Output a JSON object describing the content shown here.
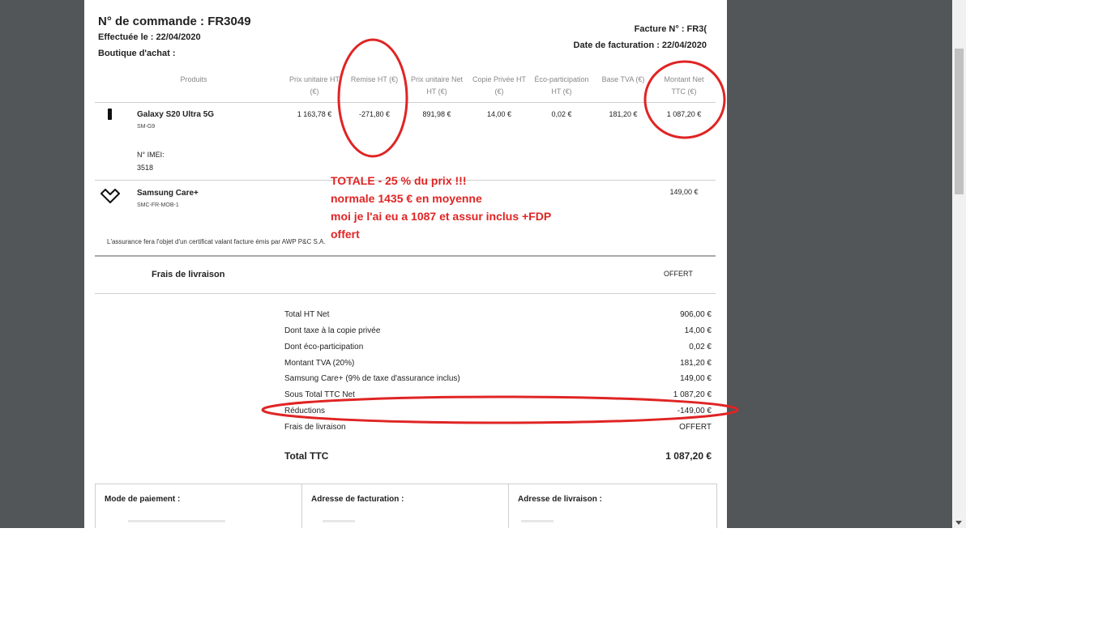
{
  "order": {
    "number_label": "N° de commande : FR3049",
    "date_label": "Effectuée le : 22/04/2020",
    "shop_label": "Boutique d'achat :",
    "invoice_number_label": "Facture N° : FR3(",
    "invoice_date_label": "Date de facturation : 22/04/2020"
  },
  "table": {
    "headers": [
      "Produits",
      "Prix unitaire HT",
      "(€)",
      "Remise HT (€)",
      "Prix unitaire Net",
      "HT (€)",
      "Copie Privée HT",
      "(€)",
      "Éco-participation",
      "HT (€)",
      "Base TVA (€)",
      "Montant Net",
      "TTC (€)"
    ],
    "product": {
      "name": "Galaxy S20 Ultra 5G",
      "ref": "SM-G9",
      "imei_label": "N° IMEI:",
      "imei_value": "3518",
      "unit_price_ht": "1 163,78 €",
      "discount_ht": "-271,80 €",
      "unit_net_ht": "891,98 €",
      "private_copy": "14,00 €",
      "eco_participation": "0,02 €",
      "vat_base": "181,20 €",
      "net_ttc": "1 087,20 €"
    },
    "insurance": {
      "name": "Samsung Care+",
      "ref": "SMC-FR-MOB-1",
      "amount": "149,00 €",
      "note": "L'assurance fera l'objet d'un certificat valant facture émis par AWP P&C S.A."
    },
    "delivery": {
      "label": "Frais de livraison",
      "value": "OFFERT"
    }
  },
  "totals": [
    {
      "label": "Total HT Net",
      "value": "906,00 €"
    },
    {
      "label": "Dont taxe à la copie privée",
      "value": "14,00 €"
    },
    {
      "label": "Dont éco-participation",
      "value": "0,02 €"
    },
    {
      "label": "Montant TVA (20%)",
      "value": "181,20 €"
    },
    {
      "label": "Samsung Care+ (9% de taxe d'assurance inclus)",
      "value": "149,00 €"
    },
    {
      "label": "Sous Total TTC Net",
      "value": "1 087,20 €"
    },
    {
      "label": "Réductions",
      "value": "-149,00 €"
    },
    {
      "label": "Frais de livraison",
      "value": "OFFERT"
    }
  ],
  "grand_total": {
    "label": "Total TTC",
    "value": "1 087,20 €"
  },
  "footer_boxes": {
    "payment": "Mode de paiement :",
    "billing": "Adresse de facturation :",
    "shipping": "Adresse de livraison :"
  },
  "annotation": {
    "line1": "TOTALE  - 25 % du prix !!!",
    "line2": "normale  1435 € en moyenne",
    "line3": "moi je l'ai eu a  1087 et assur inclus +FDP",
    "line4": "offert",
    "color": "#e02424"
  },
  "icons": {
    "product": "smartphone-icon",
    "insurance": "heart-diamond-icon"
  }
}
